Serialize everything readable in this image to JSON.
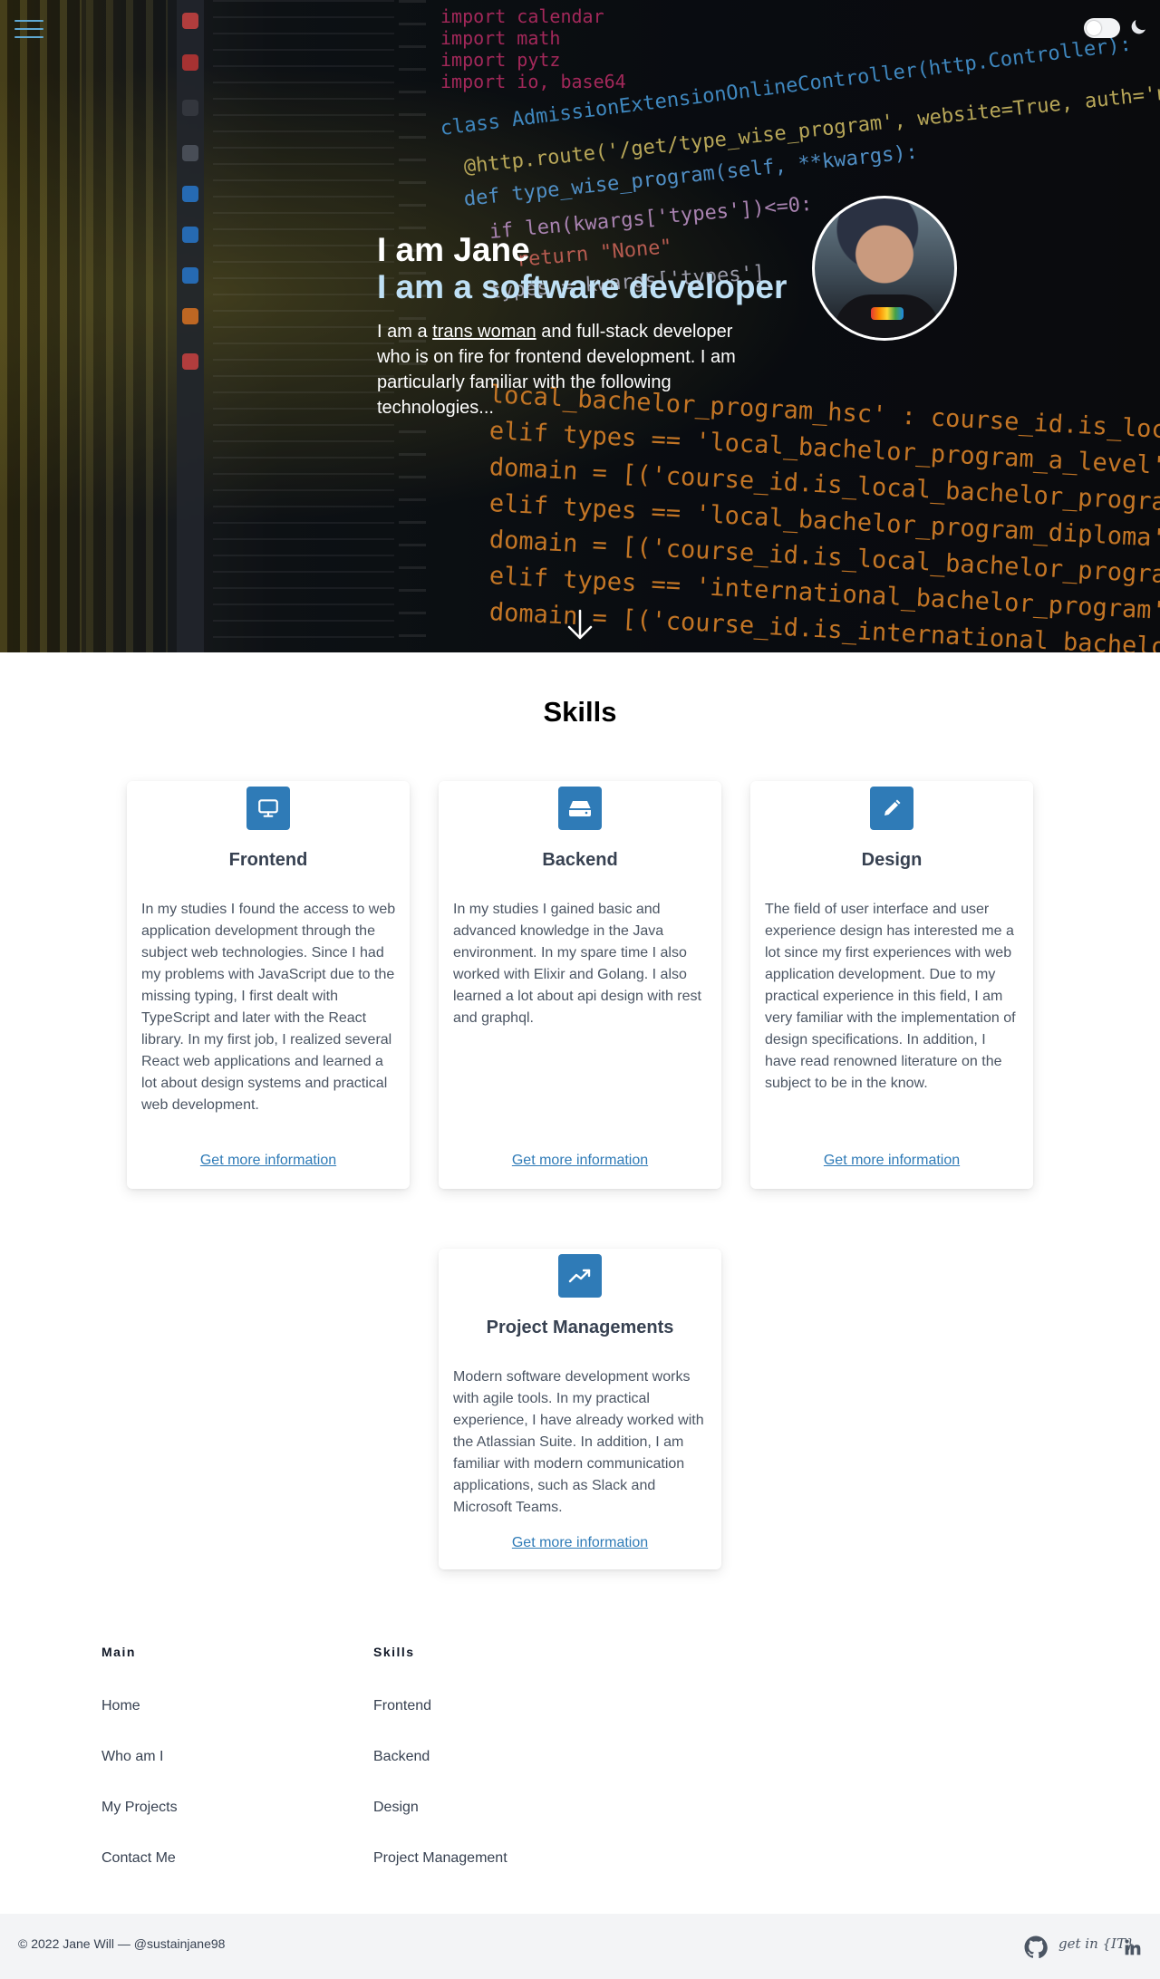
{
  "colors": {
    "accent": "#2f7bb7",
    "hero_subtitle": "#bfe0f5",
    "menu_icon": "#5fa8d3",
    "footer_background": "#f3f4f6"
  },
  "header": {
    "menu_icon": "hamburger-menu-icon",
    "theme_toggle_state": "off",
    "theme_icon": "moon-icon"
  },
  "hero": {
    "title": "I am Jane",
    "subtitle": "I am a software developer",
    "desc_before": "I am a ",
    "desc_link": "trans woman",
    "desc_after": " and full-stack developer who is on fire for frontend development. I am particularly familiar with the following technologies...",
    "scroll_icon": "arrow-down-icon"
  },
  "skills": {
    "title": "Skills",
    "cards": [
      {
        "icon": "monitor-icon",
        "title": "Frontend",
        "text": "In my studies I found the access to web application development through the subject web technologies. Since I had my problems with JavaScript due to the missing typing, I first dealt with TypeScript and later with the React library. In my first job, I realized several React web applications and learned a lot about design systems and practical web development.",
        "link": "Get more information"
      },
      {
        "icon": "server-icon",
        "title": "Backend",
        "text": "In my studies I gained basic and advanced knowledge in the Java environment. In my spare time I also worked with Elixir and Golang. I also learned a lot about api design with rest and graphql.",
        "link": "Get more information"
      },
      {
        "icon": "pencil-icon",
        "title": "Design",
        "text": "The field of user interface and user experience design has interested me a lot since my first experiences with web application development. Due to my practical experience in this field, I am very familiar with the implementation of design specifications. In addition, I have read renowned literature on the subject to be in the know.",
        "link": "Get more information"
      },
      {
        "icon": "trending-up-icon",
        "title": "Project Managements",
        "text": "Modern software development works with agile tools. In my practical experience, I have already worked with the Atlassian Suite. In addition, I am familiar with modern communication applications, such as Slack and Microsoft Teams.",
        "link": "Get more information"
      }
    ]
  },
  "footer": {
    "main": {
      "heading": "Main",
      "links": [
        "Home",
        "Who am I",
        "My Projects",
        "Contact Me"
      ]
    },
    "skills": {
      "heading": "Skills",
      "links": [
        "Frontend",
        "Backend",
        "Design",
        "Project Management"
      ]
    },
    "copyright": "© 2022 Jane Will — @sustainjane98",
    "social": {
      "github_icon": "github-icon",
      "getin_logo": "get in {IT}",
      "linkedin_icon": "linkedin-icon"
    }
  }
}
